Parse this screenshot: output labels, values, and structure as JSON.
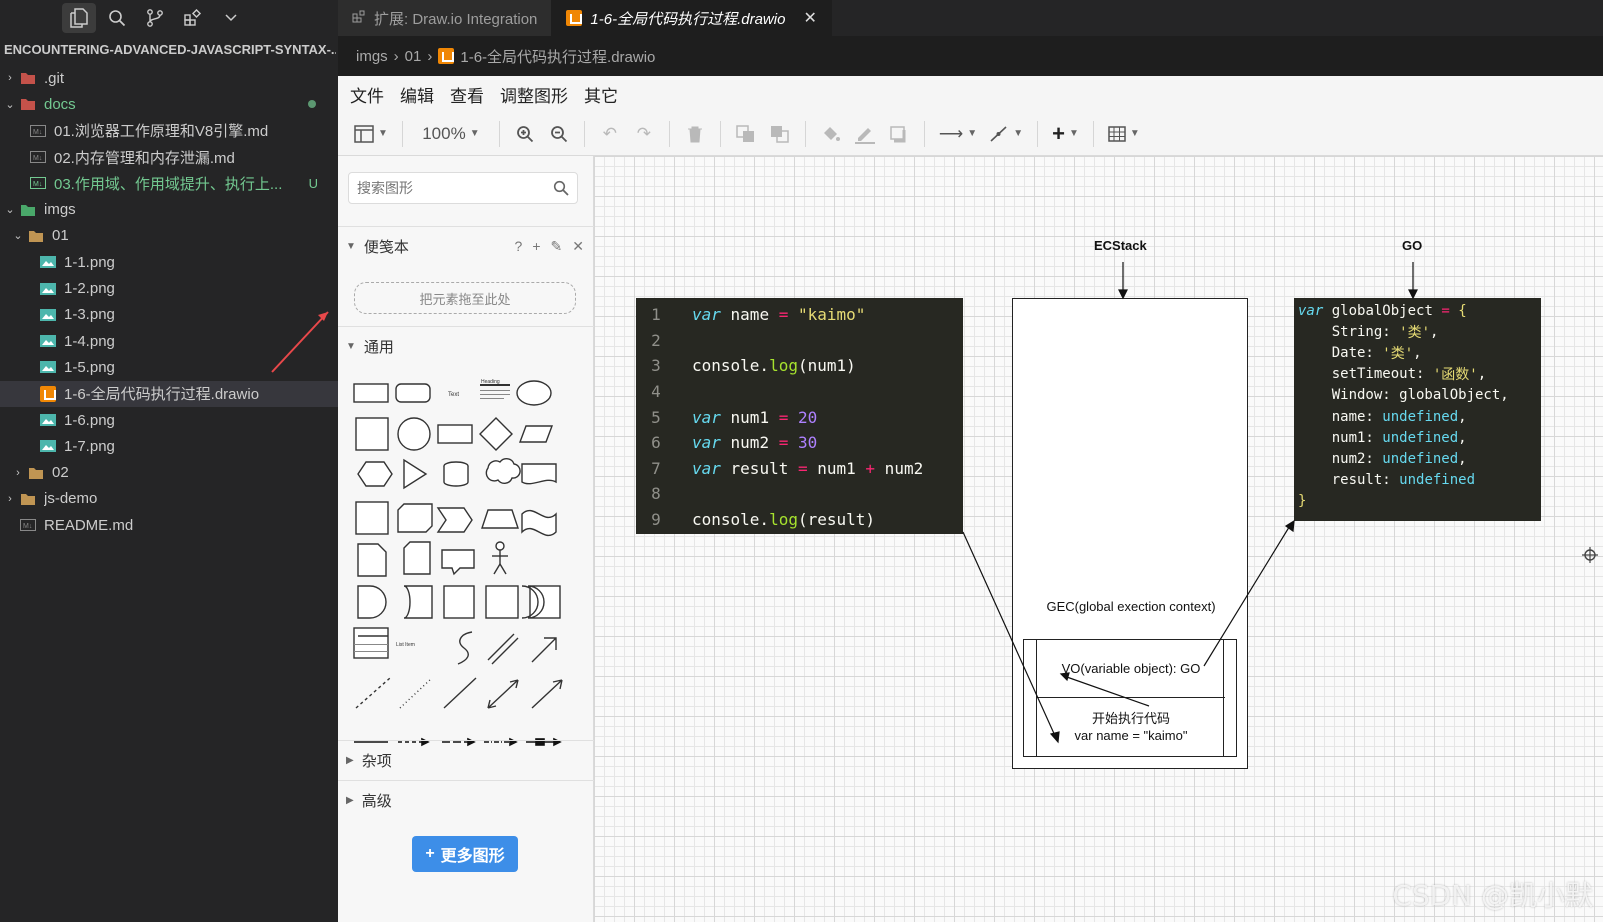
{
  "explorer": {
    "title": "ENCOUNTERING-ADVANCED-JAVASCRIPT-SYNTAX-...",
    "items": [
      {
        "label": ".git",
        "badge": ""
      },
      {
        "label": "docs",
        "badge": ""
      },
      {
        "label": "01.浏览器工作原理和V8引擎.md",
        "badge": ""
      },
      {
        "label": "02.内存管理和内存泄漏.md",
        "badge": ""
      },
      {
        "label": "03.作用域、作用域提升、执行上...",
        "badge": "U"
      },
      {
        "label": "imgs",
        "badge": ""
      },
      {
        "label": "01",
        "badge": ""
      },
      {
        "label": "1-1.png",
        "badge": ""
      },
      {
        "label": "1-2.png",
        "badge": ""
      },
      {
        "label": "1-3.png",
        "badge": ""
      },
      {
        "label": "1-4.png",
        "badge": ""
      },
      {
        "label": "1-5.png",
        "badge": ""
      },
      {
        "label": "1-6-全局代码执行过程.drawio",
        "badge": ""
      },
      {
        "label": "1-6.png",
        "badge": ""
      },
      {
        "label": "1-7.png",
        "badge": ""
      },
      {
        "label": "02",
        "badge": ""
      },
      {
        "label": "js-demo",
        "badge": ""
      },
      {
        "label": "README.md",
        "badge": ""
      }
    ]
  },
  "tabs": [
    {
      "label": "扩展: Draw.io Integration"
    },
    {
      "label": "1-6-全局代码执行过程.drawio",
      "close": "✕"
    }
  ],
  "breadcrumb": {
    "part1": "imgs",
    "part2": "01",
    "file": "1-6-全局代码执行过程.drawio",
    "sep": "›"
  },
  "menu": [
    "文件",
    "编辑",
    "查看",
    "调整图形",
    "其它"
  ],
  "toolbar": {
    "zoom": "100%"
  },
  "sidebar": {
    "search_placeholder": "搜索图形",
    "scratchpad": "便笺本",
    "dropzone": "把元素拖至此处",
    "general": "通用",
    "misc": "杂项",
    "advanced": "高级",
    "more_shapes": "更多图形",
    "shape_texts": {
      "text": "Text",
      "heading": "Heading",
      "list": "List Item"
    }
  },
  "diagram": {
    "code_lines": [
      {
        "n": "1",
        "tokens": [
          [
            "kw",
            "var"
          ],
          [
            "t",
            " name "
          ],
          [
            "op",
            "="
          ],
          [
            "t",
            " "
          ],
          [
            "str",
            "\"kaimo\""
          ]
        ]
      },
      {
        "n": "2",
        "tokens": []
      },
      {
        "n": "3",
        "tokens": [
          [
            "t",
            "console."
          ],
          [
            "fn",
            "log"
          ],
          [
            "t",
            "(num1)"
          ]
        ]
      },
      {
        "n": "4",
        "tokens": []
      },
      {
        "n": "5",
        "tokens": [
          [
            "kw",
            "var"
          ],
          [
            "t",
            " num1 "
          ],
          [
            "op",
            "="
          ],
          [
            "t",
            " "
          ],
          [
            "num",
            "20"
          ]
        ]
      },
      {
        "n": "6",
        "tokens": [
          [
            "kw",
            "var"
          ],
          [
            "t",
            " num2 "
          ],
          [
            "op",
            "="
          ],
          [
            "t",
            " "
          ],
          [
            "num",
            "30"
          ]
        ]
      },
      {
        "n": "7",
        "tokens": [
          [
            "kw",
            "var"
          ],
          [
            "t",
            " result "
          ],
          [
            "op",
            "="
          ],
          [
            "t",
            " num1 "
          ],
          [
            "op",
            "+"
          ],
          [
            "t",
            " num2"
          ]
        ]
      },
      {
        "n": "8",
        "tokens": []
      },
      {
        "n": "9",
        "tokens": [
          [
            "t",
            "console."
          ],
          [
            "fn",
            "log"
          ],
          [
            "t",
            "(result)"
          ]
        ]
      }
    ],
    "ec_stack_label": "ECStack",
    "go_label": "GO",
    "gec_label": "GEC(global exection context)",
    "vo_text": "VO(variable object):  GO",
    "exec_line1": "开始执行代码",
    "exec_line2": "var name = \"kaimo\"",
    "go_lines": [
      [
        [
          "kw",
          "var"
        ],
        [
          "t",
          " globalObject "
        ],
        [
          "op",
          "="
        ],
        [
          "t",
          " "
        ],
        [
          "brace",
          "{"
        ]
      ],
      [
        [
          "t",
          "    String: "
        ],
        [
          "str",
          "'类'"
        ],
        [
          "t",
          ","
        ]
      ],
      [
        [
          "t",
          "    Date: "
        ],
        [
          "str",
          "'类'"
        ],
        [
          "t",
          ","
        ]
      ],
      [
        [
          "t",
          "    setTimeout: "
        ],
        [
          "str",
          "'函数'"
        ],
        [
          "t",
          ","
        ]
      ],
      [
        [
          "t",
          "    Window: globalObject,"
        ]
      ],
      [
        [
          "t",
          "    name: "
        ],
        [
          "undef",
          "undefined"
        ],
        [
          "t",
          ","
        ]
      ],
      [
        [
          "t",
          "    num1: "
        ],
        [
          "undef",
          "undefined"
        ],
        [
          "t",
          ","
        ]
      ],
      [
        [
          "t",
          "    num2: "
        ],
        [
          "undef",
          "undefined"
        ],
        [
          "t",
          ","
        ]
      ],
      [
        [
          "t",
          "    result: "
        ],
        [
          "undef",
          "undefined"
        ]
      ],
      [
        [
          "brace",
          "}"
        ]
      ]
    ]
  },
  "watermark": "CSDN @凯小默",
  "colors": {
    "accent": "#3d8ee8",
    "modified": "#73c991",
    "drawio": "#f08705"
  }
}
